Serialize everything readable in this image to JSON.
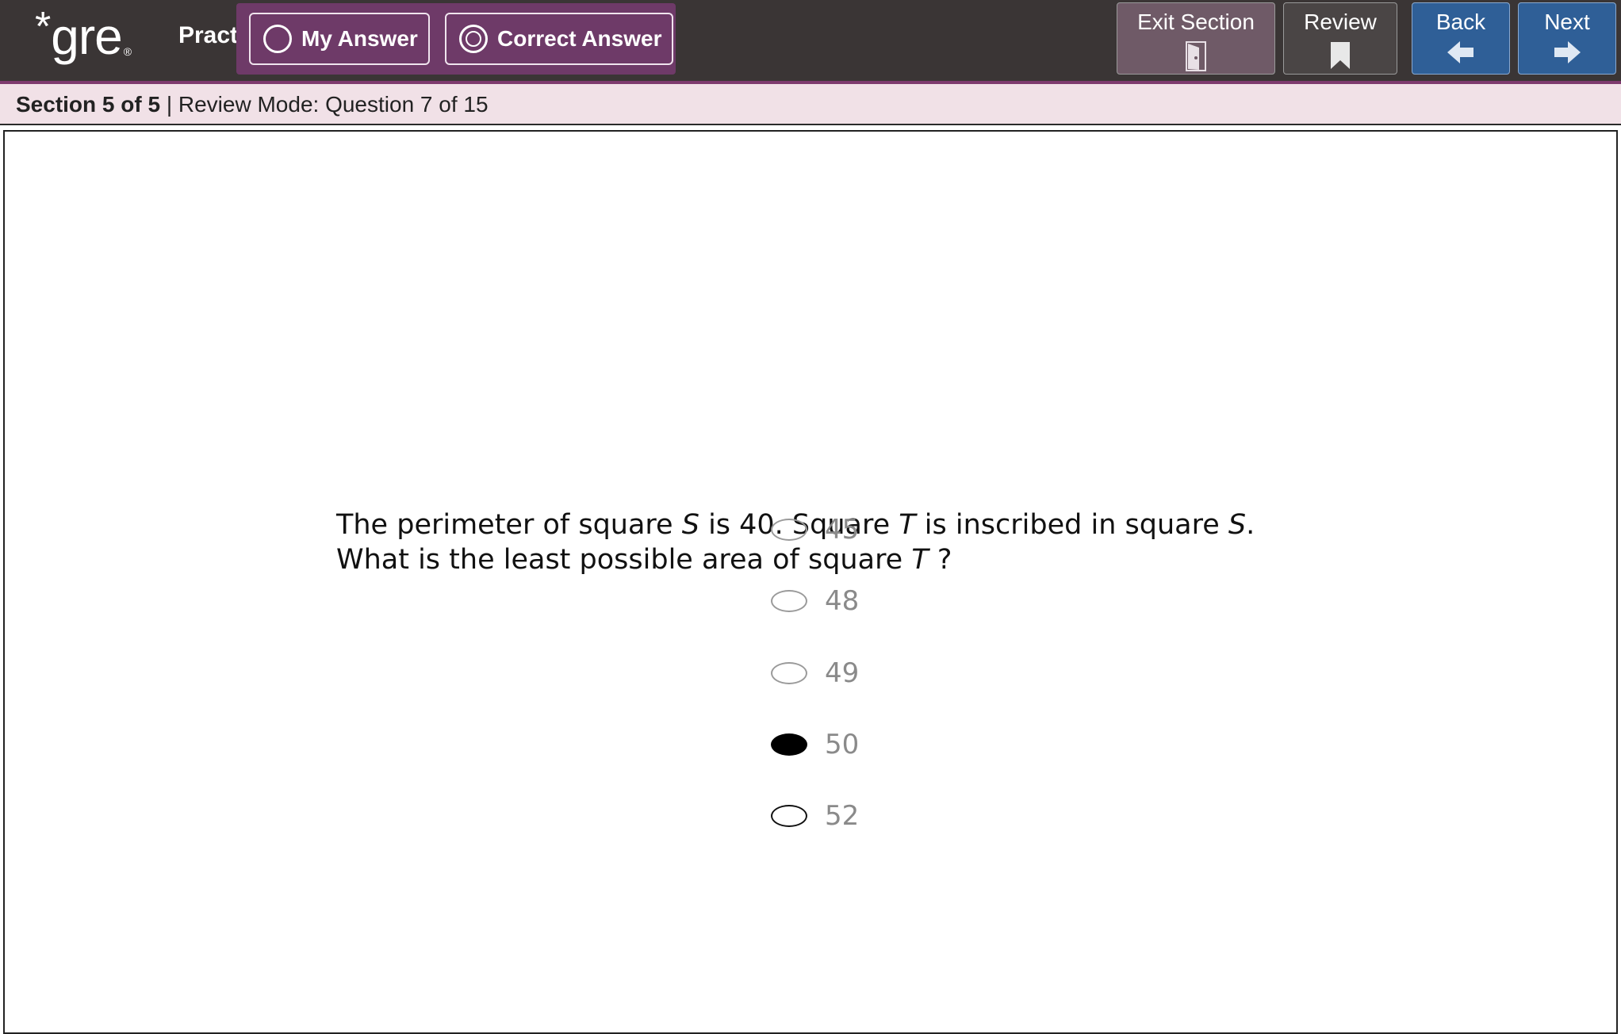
{
  "app": {
    "logo_mark": "*",
    "logo_text": "gre",
    "logo_registered": "®",
    "mode_label": "Practice Test"
  },
  "toggles": {
    "my_answer": "My Answer",
    "correct_answer": "Correct Answer",
    "active": "correct_answer"
  },
  "toolbar": {
    "exit_section": "Exit Section",
    "review": "Review",
    "back": "Back",
    "next": "Next",
    "icons": {
      "exit_section": "door-icon",
      "review": "bookmark-icon",
      "back": "arrow-left-icon",
      "next": "arrow-right-icon"
    }
  },
  "status": {
    "section": "Section 5 of 5",
    "separator": " | ",
    "mode": "Review Mode: Question 7 of 15"
  },
  "question": {
    "line1_a": "The perimeter of square ",
    "var_s": "S",
    "line1_b": " is 40. Square ",
    "var_t": "T",
    "line1_c": " is inscribed in square ",
    "line1_end": ".",
    "line2_a": "What is the least possible area of square ",
    "line2_end": " ?"
  },
  "choices": [
    {
      "value": "45",
      "state": "unselected"
    },
    {
      "value": "48",
      "state": "unselected"
    },
    {
      "value": "49",
      "state": "unselected"
    },
    {
      "value": "50",
      "state": "selected"
    },
    {
      "value": "52",
      "state": "outlined"
    }
  ],
  "colors": {
    "topbar": "#3a3535",
    "accent_purple": "#6e3a68",
    "nav_blue": "#2f5f97",
    "status_bg": "#f1e1e7"
  }
}
